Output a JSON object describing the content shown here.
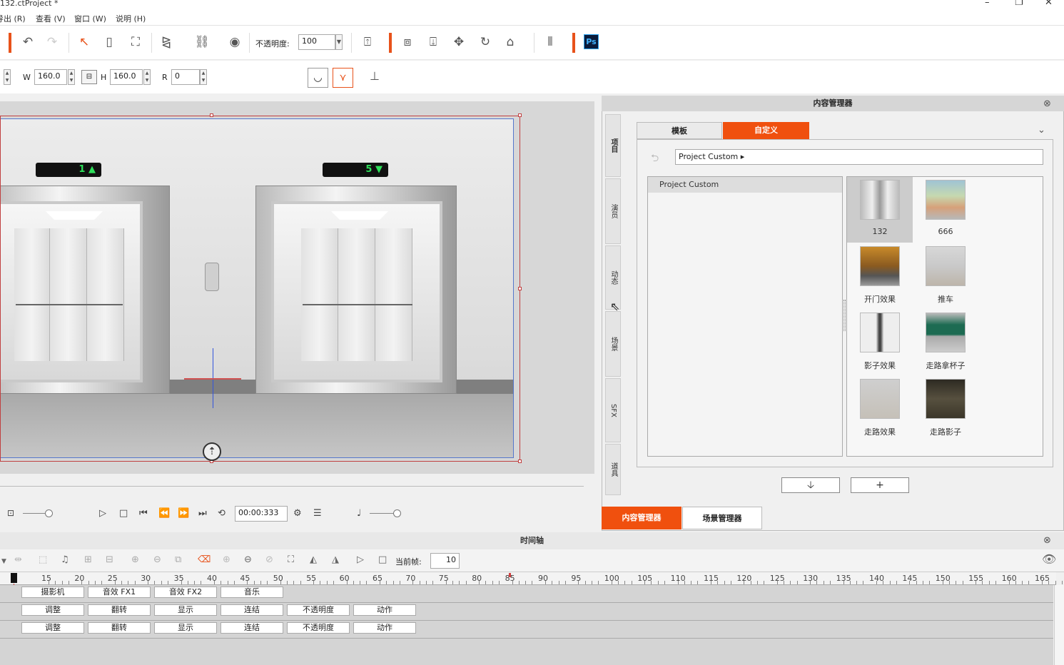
{
  "window": {
    "title": "132.ctProject *",
    "controls": [
      "–",
      "❐",
      "✕"
    ]
  },
  "menu": [
    "导出 (R)",
    "查看 (V)",
    "窗口 (W)",
    "说明 (H)"
  ],
  "toolbar": {
    "opacity_label": "不透明度:",
    "opacity_value": "100",
    "ps_label": "Ps"
  },
  "transform": {
    "w_label": "W",
    "w_value": "160.0",
    "h_label": "H",
    "h_value": "160.0",
    "r_label": "R",
    "r_value": "0"
  },
  "stage": {
    "floor_left": "1",
    "floor_right": "5"
  },
  "playback": {
    "time": "00:00:333"
  },
  "content_manager": {
    "title": "内容管理器",
    "tabs": [
      "模板",
      "自定义"
    ],
    "side_tabs": [
      "项目",
      "演员",
      "动态",
      "场景",
      "SFX",
      "道具"
    ],
    "path": "Project Custom ▸",
    "tree_header": "Project Custom",
    "items": [
      "132",
      "666",
      "开门效果",
      "推车",
      "影子效果",
      "走路拿杯子",
      "走路效果",
      "走路影子"
    ],
    "btn_down": "🡣",
    "btn_add": "+",
    "bottom_tabs": [
      "内容管理器",
      "场景管理器"
    ]
  },
  "timeline": {
    "title": "时间轴",
    "current_frame_label": "当前帧:",
    "current_frame_value": "10",
    "ticks": [
      "15",
      "20",
      "25",
      "30",
      "35",
      "40",
      "45",
      "50",
      "55",
      "60",
      "65",
      "70",
      "75",
      "80",
      "85",
      "90",
      "95",
      "100",
      "105",
      "110",
      "115",
      "120",
      "125",
      "130",
      "135",
      "140",
      "145",
      "150",
      "155",
      "160",
      "165"
    ],
    "row1": [
      "摄影机",
      "音效 FX1",
      "音效 FX2",
      "音乐"
    ],
    "row2": [
      "调整",
      "翻转",
      "显示",
      "连结",
      "不透明度",
      "动作"
    ],
    "row3": [
      "调整",
      "翻转",
      "显示",
      "连结",
      "不透明度",
      "动作"
    ]
  },
  "colors": {
    "accent": "#e8521a",
    "selected_tab": "#f0500e"
  }
}
